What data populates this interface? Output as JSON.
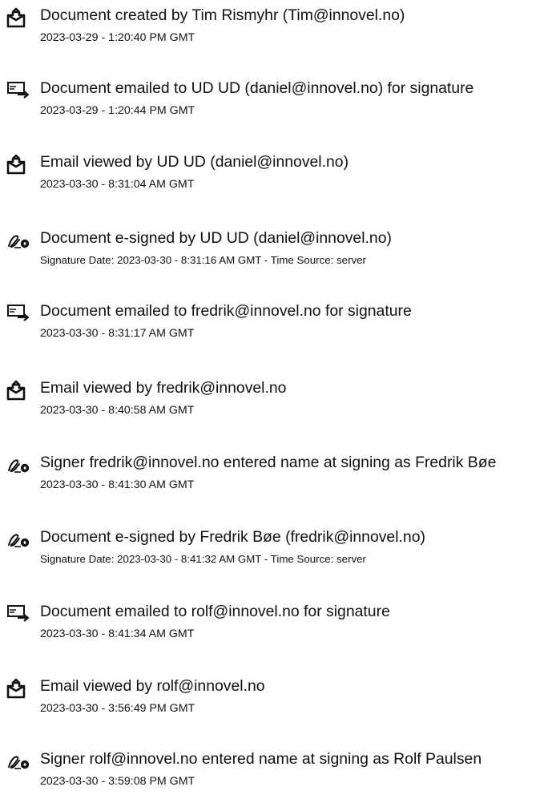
{
  "events": [
    {
      "icon": "document-created-icon",
      "title": "Document created by Tim Rismyhr (Tim@innovel.no)",
      "time": "2023-03-29 - 1:20:40 PM GMT"
    },
    {
      "icon": "email-sent-icon",
      "title": "Document emailed to UD UD (daniel@innovel.no) for signature",
      "time": "2023-03-29 - 1:20:44 PM GMT"
    },
    {
      "icon": "email-viewed-icon",
      "title": "Email viewed by UD UD (daniel@innovel.no)",
      "time": "2023-03-30 - 8:31:04 AM GMT"
    },
    {
      "icon": "esign-icon",
      "title": "Document e-signed by UD UD (daniel@innovel.no)",
      "time": "Signature Date: 2023-03-30 - 8:31:16 AM GMT - Time Source: server"
    },
    {
      "icon": "email-sent-icon",
      "title": "Document emailed to fredrik@innovel.no for signature",
      "time": "2023-03-30 - 8:31:17 AM GMT"
    },
    {
      "icon": "email-viewed-icon",
      "title": "Email viewed by fredrik@innovel.no",
      "time": "2023-03-30 - 8:40:58 AM GMT"
    },
    {
      "icon": "esign-icon",
      "title": "Signer fredrik@innovel.no entered name at signing as Fredrik Bøe",
      "time": "2023-03-30 - 8:41:30 AM GMT"
    },
    {
      "icon": "esign-icon",
      "title": "Document e-signed by Fredrik Bøe (fredrik@innovel.no)",
      "time": "Signature Date: 2023-03-30 - 8:41:32 AM GMT - Time Source: server"
    },
    {
      "icon": "email-sent-icon",
      "title": "Document emailed to rolf@innovel.no for signature",
      "time": "2023-03-30 - 8:41:34 AM GMT"
    },
    {
      "icon": "email-viewed-icon",
      "title": "Email viewed by rolf@innovel.no",
      "time": "2023-03-30 - 3:56:49 PM GMT"
    },
    {
      "icon": "esign-icon",
      "title": "Signer rolf@innovel.no entered name at signing as Rolf Paulsen",
      "time": "2023-03-30 - 3:59:08 PM GMT"
    }
  ]
}
